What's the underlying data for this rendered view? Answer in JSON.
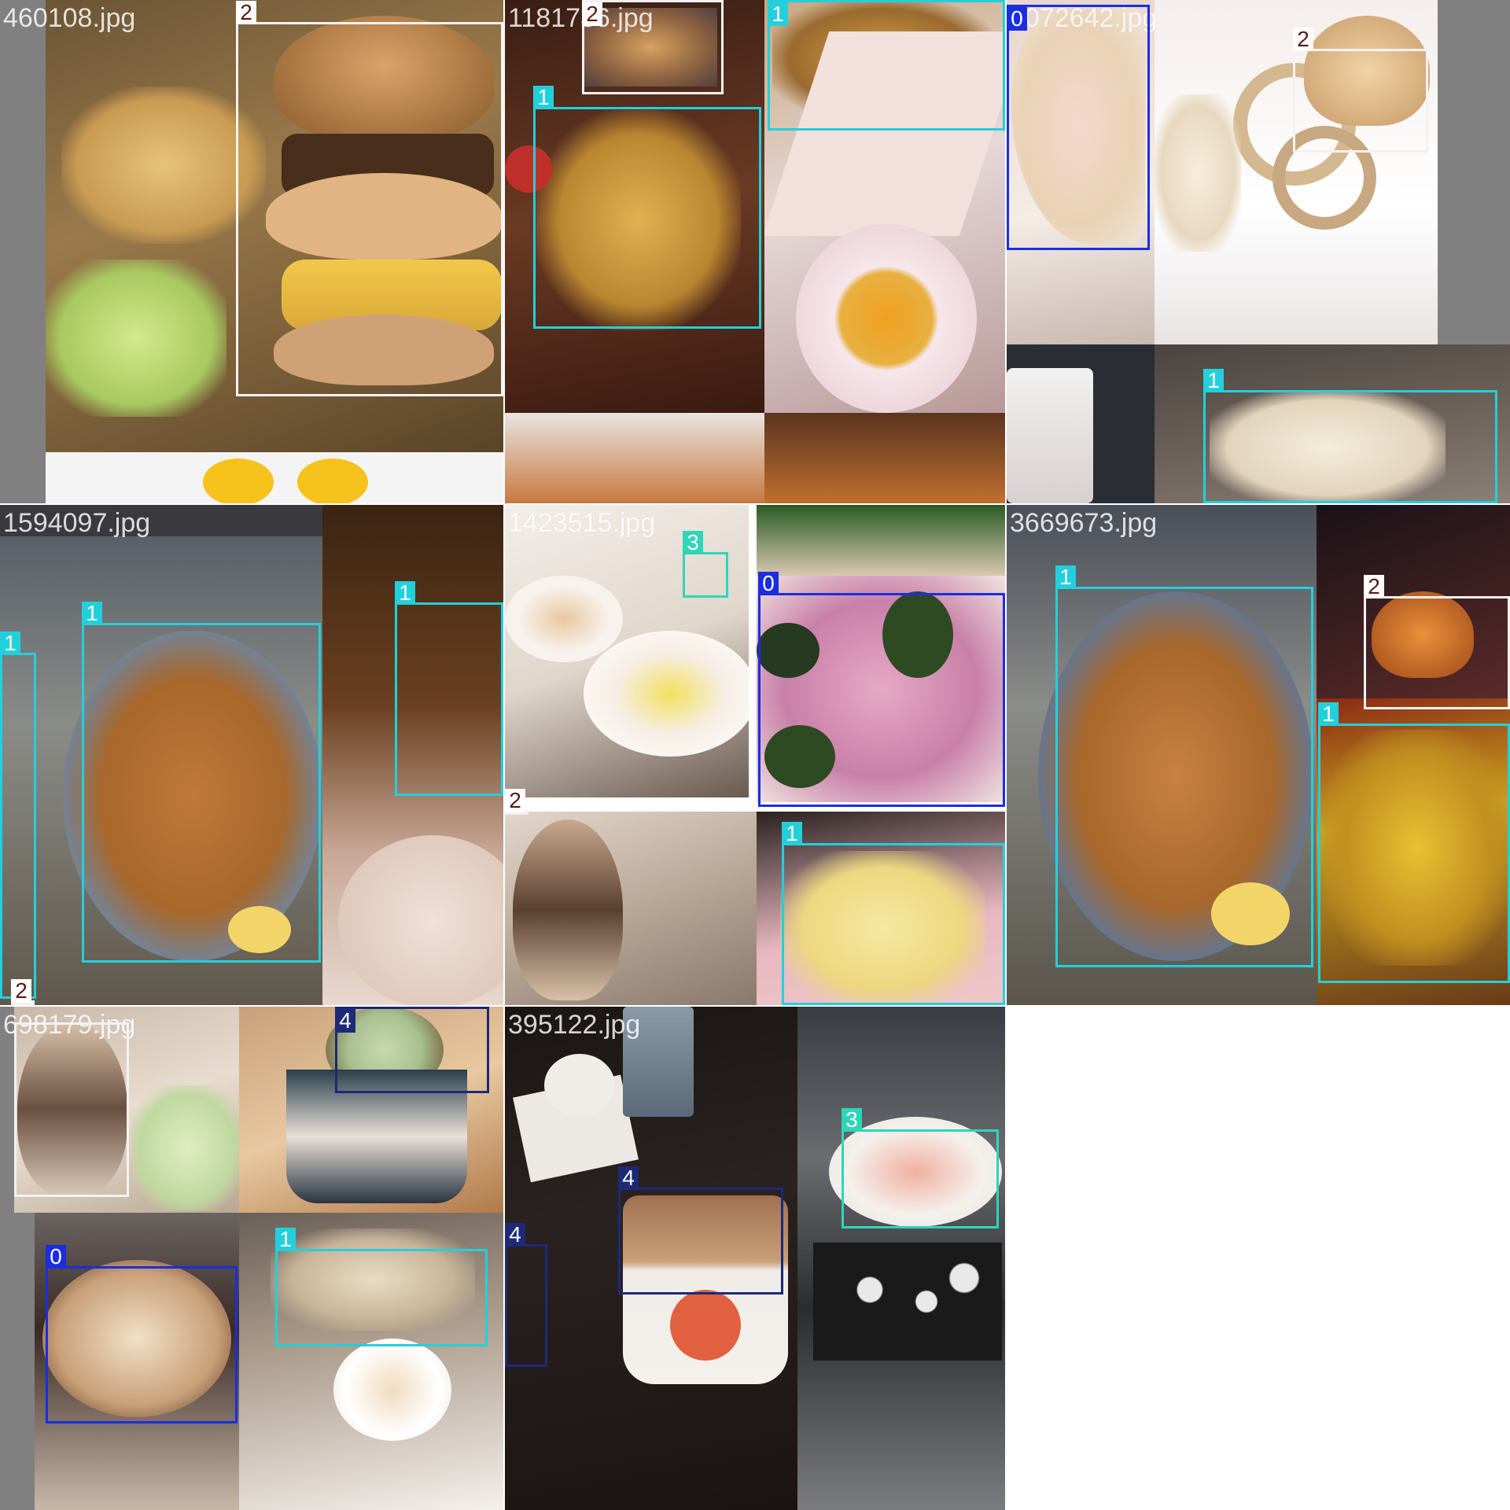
{
  "tiles": [
    {
      "filename": "460108.jpg",
      "boxes": [
        {
          "label": "2"
        }
      ]
    },
    {
      "filename": "1181736.jpg",
      "boxes": [
        {
          "label": "2"
        },
        {
          "label": "1"
        },
        {
          "label": "1"
        }
      ]
    },
    {
      "filename": "1072642.jpg",
      "boxes": [
        {
          "label": "0"
        },
        {
          "label": "2"
        },
        {
          "label": "1"
        }
      ]
    },
    {
      "filename": "1594097.jpg",
      "boxes": [
        {
          "label": "1"
        },
        {
          "label": "1"
        },
        {
          "label": "1"
        },
        {
          "label": "2"
        }
      ]
    },
    {
      "filename": "1423515.jpg",
      "boxes": [
        {
          "label": "3"
        },
        {
          "label": "0"
        },
        {
          "label": "2"
        },
        {
          "label": "1"
        }
      ]
    },
    {
      "filename": "3669673.jpg",
      "boxes": [
        {
          "label": "1"
        },
        {
          "label": "2"
        },
        {
          "label": "1"
        }
      ]
    },
    {
      "filename": "698179.jpg",
      "boxes": [
        {
          "label": "4"
        },
        {
          "label": "0"
        },
        {
          "label": "1"
        }
      ]
    },
    {
      "filename": "395122.jpg",
      "boxes": [
        {
          "label": "4"
        },
        {
          "label": "4"
        },
        {
          "label": "3"
        }
      ]
    }
  ],
  "class_colors": {
    "0": "#1a2ee0",
    "1": "#22d0dc",
    "2": "#f2f2f2",
    "3": "#2ed6b8",
    "4": "#1c2a78"
  },
  "label_text_colors": {
    "2": "#5a1a10"
  }
}
